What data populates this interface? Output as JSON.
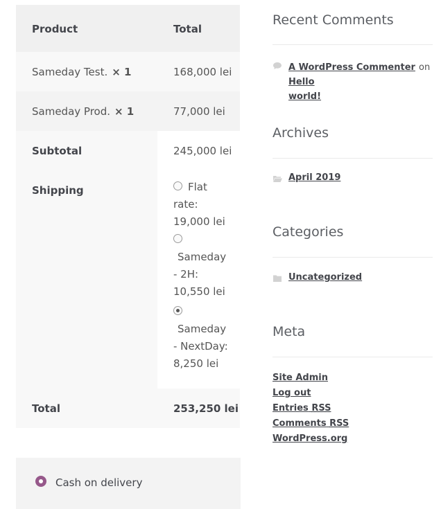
{
  "order": {
    "header": {
      "product": "Product",
      "total": "Total"
    },
    "items": [
      {
        "name": "Sameday Test.",
        "qty": "× 1",
        "total": "168,000 lei"
      },
      {
        "name": "Sameday Prod.",
        "qty": "× 1",
        "total": "77,000 lei"
      }
    ],
    "subtotal": {
      "label": "Subtotal",
      "value": "245,000 lei"
    },
    "shipping": {
      "label": "Shipping",
      "options": [
        {
          "lines": [
            "Flat",
            "rate:",
            "19,000 lei"
          ],
          "checked": false
        },
        {
          "lines": [
            "Sameday",
            "- 2H:",
            "10,550 lei"
          ],
          "checked": false
        },
        {
          "lines": [
            "Sameday",
            "- NextDay:",
            "8,250 lei"
          ],
          "checked": true
        }
      ]
    },
    "total": {
      "label": "Total",
      "value": "253,250 lei"
    }
  },
  "payment": {
    "label": "Cash on delivery",
    "accent": "#96588a"
  },
  "sidebar": {
    "recent_comments": {
      "title": "Recent Comments",
      "author": "A WordPress Commenter",
      "on": "on",
      "post_line1": "Hello",
      "post_line2": "world!"
    },
    "archives": {
      "title": "Archives",
      "item": "April 2019"
    },
    "categories": {
      "title": "Categories",
      "item": "Uncategorized"
    },
    "meta": {
      "title": "Meta",
      "site_admin": "Site Admin",
      "log_out": "Log out",
      "entries_prefix": "Entries",
      "comments_prefix": "Comments",
      "rss": "RSS",
      "wordpress_org": "WordPress.org"
    }
  }
}
